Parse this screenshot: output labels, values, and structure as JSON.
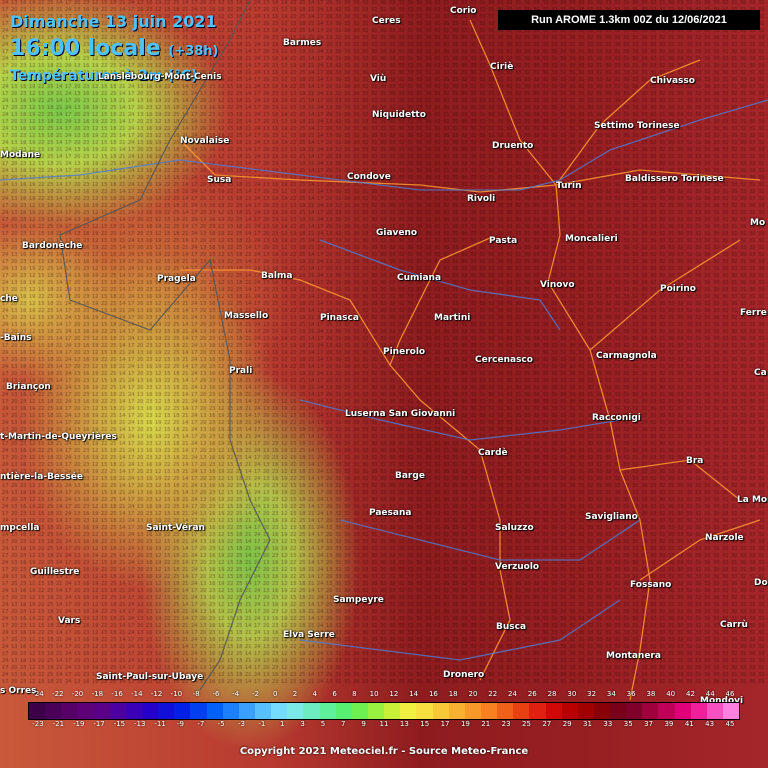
{
  "header": {
    "date": "Dimanche 13 juin 2021",
    "time": "16:00 locale",
    "time_offset": "(+38h)",
    "parameter": "Températures à 2m (°C)",
    "run": "Run AROME 1.3km 00Z du 12/06/2021"
  },
  "cities": [
    {
      "name": "Corio",
      "pos": [
        450,
        6
      ]
    },
    {
      "name": "Ceres",
      "pos": [
        372,
        16
      ]
    },
    {
      "name": "Barmes",
      "pos": [
        283,
        38
      ]
    },
    {
      "name": "Lanslebourg-Mont-Cenis",
      "pos": [
        98,
        72
      ]
    },
    {
      "name": "Viù",
      "pos": [
        370,
        74
      ]
    },
    {
      "name": "Ciriè",
      "pos": [
        490,
        62
      ]
    },
    {
      "name": "Chivasso",
      "pos": [
        650,
        76
      ]
    },
    {
      "name": "Niquidetto",
      "pos": [
        372,
        110
      ]
    },
    {
      "name": "Novalaise",
      "pos": [
        180,
        136
      ]
    },
    {
      "name": "Settimo Torinese",
      "pos": [
        594,
        121
      ]
    },
    {
      "name": "Modane",
      "pos": [
        0,
        150
      ]
    },
    {
      "name": "Druento",
      "pos": [
        492,
        141
      ]
    },
    {
      "name": "Susa",
      "pos": [
        207,
        175
      ]
    },
    {
      "name": "Condove",
      "pos": [
        347,
        172
      ]
    },
    {
      "name": "Baldissero Torinese",
      "pos": [
        625,
        174
      ]
    },
    {
      "name": "Turin",
      "pos": [
        556,
        181
      ]
    },
    {
      "name": "Rivoli",
      "pos": [
        467,
        194
      ]
    },
    {
      "name": "Mo",
      "pos": [
        750,
        218
      ]
    },
    {
      "name": "Giaveno",
      "pos": [
        376,
        228
      ]
    },
    {
      "name": "Pasta",
      "pos": [
        489,
        236
      ]
    },
    {
      "name": "Moncalieri",
      "pos": [
        565,
        234
      ]
    },
    {
      "name": "Bardonèche",
      "pos": [
        22,
        241
      ]
    },
    {
      "name": "Pragela",
      "pos": [
        157,
        274
      ]
    },
    {
      "name": "Balma",
      "pos": [
        261,
        271
      ]
    },
    {
      "name": "Cumiana",
      "pos": [
        397,
        273
      ]
    },
    {
      "name": "Vinovo",
      "pos": [
        540,
        280
      ]
    },
    {
      "name": "Poirino",
      "pos": [
        660,
        284
      ]
    },
    {
      "name": "che",
      "pos": [
        0,
        294
      ]
    },
    {
      "name": "Massello",
      "pos": [
        224,
        311
      ]
    },
    {
      "name": "Pinasca",
      "pos": [
        320,
        313
      ]
    },
    {
      "name": "Martini",
      "pos": [
        434,
        313
      ]
    },
    {
      "name": "Ferre",
      "pos": [
        740,
        308
      ]
    },
    {
      "name": "-Bains",
      "pos": [
        0,
        333
      ]
    },
    {
      "name": "Pinerolo",
      "pos": [
        383,
        347
      ]
    },
    {
      "name": "Cercenasco",
      "pos": [
        475,
        355
      ]
    },
    {
      "name": "Carmagnola",
      "pos": [
        596,
        351
      ]
    },
    {
      "name": "Prali",
      "pos": [
        229,
        366
      ]
    },
    {
      "name": "Ca",
      "pos": [
        754,
        368
      ]
    },
    {
      "name": "Briançon",
      "pos": [
        6,
        382
      ]
    },
    {
      "name": "Luserna San Giovanni",
      "pos": [
        345,
        409
      ]
    },
    {
      "name": "Racconigi",
      "pos": [
        592,
        413
      ]
    },
    {
      "name": "t-Martin-de-Queyrières",
      "pos": [
        0,
        432
      ]
    },
    {
      "name": "Cardè",
      "pos": [
        478,
        448
      ]
    },
    {
      "name": "Bra",
      "pos": [
        686,
        456
      ]
    },
    {
      "name": "ntière-la-Bessée",
      "pos": [
        0,
        472
      ]
    },
    {
      "name": "Barge",
      "pos": [
        395,
        471
      ]
    },
    {
      "name": "La Mor",
      "pos": [
        737,
        495
      ]
    },
    {
      "name": "Paesana",
      "pos": [
        369,
        508
      ]
    },
    {
      "name": "Savigliano",
      "pos": [
        585,
        512
      ]
    },
    {
      "name": "mpcella",
      "pos": [
        0,
        523
      ]
    },
    {
      "name": "Saint-Véran",
      "pos": [
        146,
        523
      ]
    },
    {
      "name": "Saluzzo",
      "pos": [
        495,
        523
      ]
    },
    {
      "name": "Narzole",
      "pos": [
        705,
        533
      ]
    },
    {
      "name": "Verzuolo",
      "pos": [
        495,
        562
      ]
    },
    {
      "name": "Guillestre",
      "pos": [
        30,
        567
      ]
    },
    {
      "name": "Fossano",
      "pos": [
        630,
        580
      ]
    },
    {
      "name": "Do",
      "pos": [
        754,
        578
      ]
    },
    {
      "name": "Sampeyre",
      "pos": [
        333,
        595
      ]
    },
    {
      "name": "Vars",
      "pos": [
        58,
        616
      ]
    },
    {
      "name": "Busca",
      "pos": [
        496,
        622
      ]
    },
    {
      "name": "Carrù",
      "pos": [
        720,
        620
      ]
    },
    {
      "name": "Elva Serre",
      "pos": [
        283,
        630
      ]
    },
    {
      "name": "Montanera",
      "pos": [
        606,
        651
      ]
    },
    {
      "name": "Dronero",
      "pos": [
        443,
        670
      ]
    },
    {
      "name": "Saint-Paul-sur-Ubaye",
      "pos": [
        96,
        672
      ]
    },
    {
      "name": "s Orres",
      "pos": [
        0,
        686
      ]
    },
    {
      "name": "Mondovi",
      "pos": [
        700,
        696
      ]
    }
  ],
  "legend": {
    "top_ticks": [
      "-24",
      "-22",
      "-20",
      "-18",
      "-16",
      "-14",
      "-12",
      "-10",
      "-8",
      "-6",
      "-4",
      "-2",
      "0",
      "2",
      "4",
      "6",
      "8",
      "10",
      "12",
      "14",
      "16",
      "18",
      "20",
      "22",
      "24",
      "26",
      "28",
      "30",
      "32",
      "34",
      "36",
      "38",
      "40",
      "42",
      "44",
      "46"
    ],
    "bottom_ticks": [
      "-23",
      "-21",
      "-19",
      "-17",
      "-15",
      "-13",
      "-11",
      "-9",
      "-7",
      "-5",
      "-3",
      "-1",
      "1",
      "3",
      "5",
      "7",
      "9",
      "11",
      "13",
      "15",
      "17",
      "19",
      "21",
      "23",
      "25",
      "27",
      "29",
      "31",
      "33",
      "35",
      "37",
      "39",
      "41",
      "43",
      "45"
    ],
    "colors": [
      "#3c0048",
      "#4a0058",
      "#560068",
      "#5e0078",
      "#5a0088",
      "#4c00a0",
      "#3a00b8",
      "#2400c8",
      "#1010d8",
      "#0020e8",
      "#0040f0",
      "#0060f8",
      "#1c80fc",
      "#3aa0ff",
      "#58c0ff",
      "#76dcff",
      "#7ce8e8",
      "#6cecc0",
      "#5ef09a",
      "#58f070",
      "#6ef050",
      "#9af040",
      "#c8f038",
      "#f0f040",
      "#f8e040",
      "#f8c838",
      "#f8b030",
      "#f89828",
      "#f88020",
      "#f06018",
      "#e84010",
      "#e02010",
      "#d00808",
      "#b80000",
      "#a00000",
      "#880008",
      "#780018",
      "#80002a",
      "#a0003c",
      "#c00058",
      "#e00078",
      "#f0209c",
      "#f850c0",
      "#fc80e0"
    ]
  },
  "copyright": "Copyright 2021 Meteociel.fr - Source Meteo-France"
}
